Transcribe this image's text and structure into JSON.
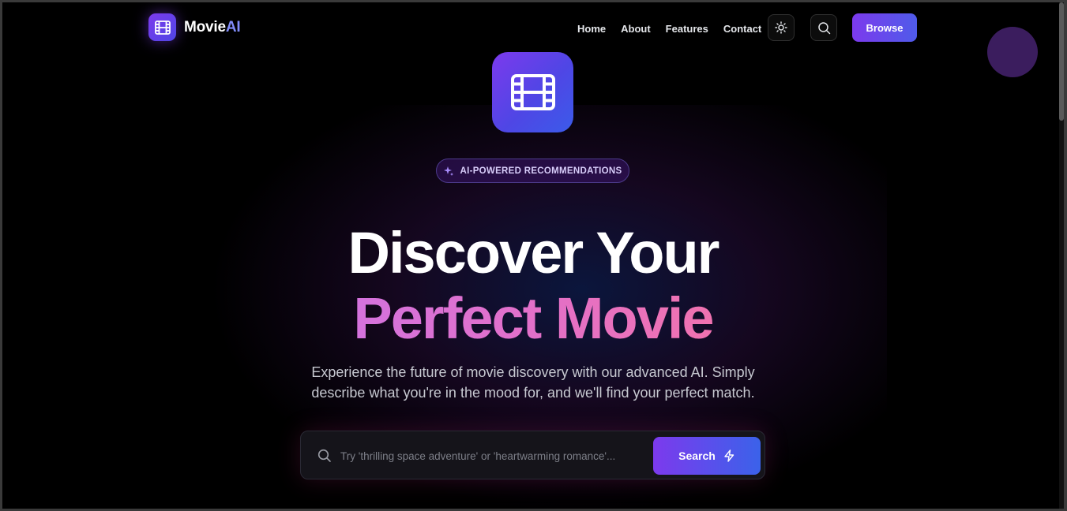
{
  "brand": {
    "name_main": "Movie",
    "name_accent": "AI",
    "icon": "film-icon"
  },
  "nav": {
    "links": [
      "Home",
      "About",
      "Features",
      "Contact"
    ],
    "theme_icon": "sun-icon",
    "search_icon": "search-icon",
    "browse_label": "Browse"
  },
  "hero": {
    "icon": "film-icon",
    "badge": "AI-POWERED RECOMMENDATIONS",
    "badge_icon": "sparkle-icon",
    "headline_line1": "Discover Your",
    "headline_line2": "Perfect Movie",
    "subtitle_line1": "Experience the future of movie discovery with our advanced AI. Simply",
    "subtitle_line2": "describe what you're in the mood for, and we'll find your perfect match."
  },
  "search": {
    "placeholder": "Try 'thrilling space adventure' or 'heartwarming romance'...",
    "button_label": "Search",
    "button_icon": "lightning-icon"
  },
  "colors": {
    "accent_purple": "#7c3aed",
    "accent_blue": "#3b62ea",
    "gradient_pink": "#f072b0",
    "gradient_violet": "#d472dd"
  }
}
